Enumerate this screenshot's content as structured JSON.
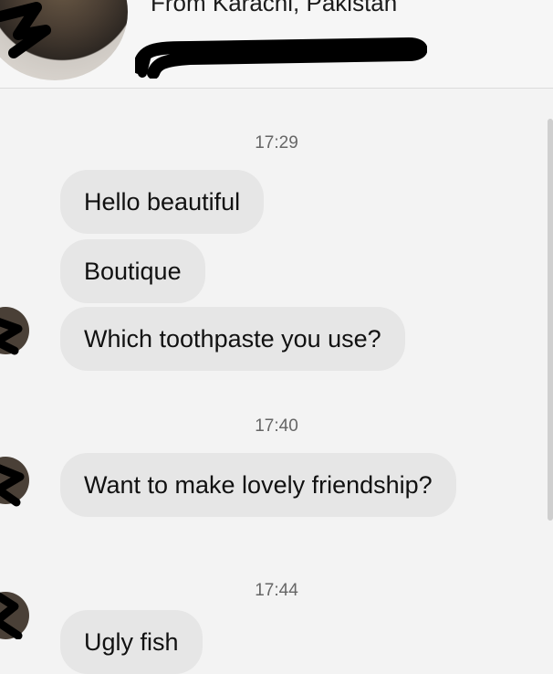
{
  "header": {
    "subtitle": "From Karachi, Pakistan"
  },
  "messages": [
    {
      "time": "17:29",
      "texts": [
        "Hello beautiful",
        "Boutique",
        "Which toothpaste you use?"
      ]
    },
    {
      "time": "17:40",
      "texts": [
        "Want to make lovely friendship?"
      ]
    },
    {
      "time": "17:44",
      "texts": [
        "Ugly fish"
      ]
    }
  ],
  "colors": {
    "background": "#f3f3f3",
    "bubble": "#e6e6e6",
    "timestamp": "#666666",
    "redaction": "#000000"
  }
}
